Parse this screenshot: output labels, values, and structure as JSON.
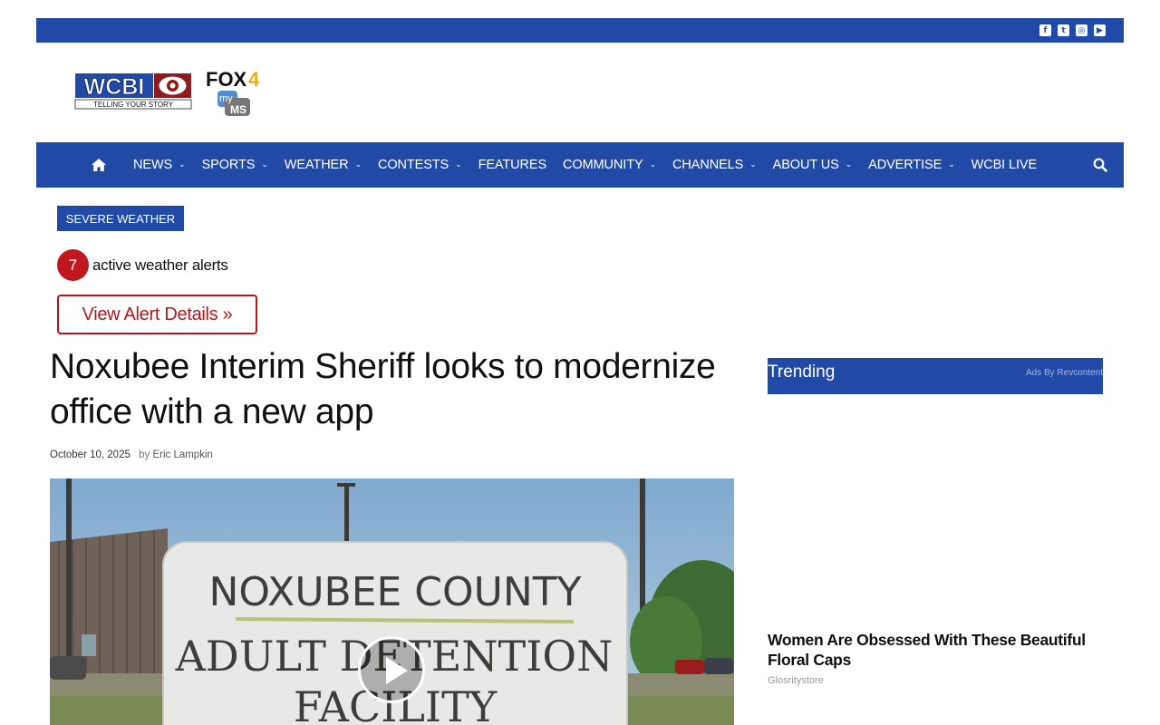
{
  "colors": {
    "brand_blue": "#2149a6",
    "alert_red": "#c0161d"
  },
  "social": [
    {
      "icon": "facebook-icon",
      "glyph": "f"
    },
    {
      "icon": "twitter-icon",
      "glyph": "t"
    },
    {
      "icon": "instagram-icon",
      "glyph": "◎"
    },
    {
      "icon": "youtube-icon",
      "glyph": "▶"
    }
  ],
  "logos": {
    "wcbi_text": "WCBI",
    "wcbi_tagline": "TELLING YOUR STORY",
    "fox_text": "FOX",
    "fox_number": "4",
    "my_text": "my",
    "ms_text": "MS"
  },
  "nav": {
    "items": [
      {
        "label": "NEWS",
        "dropdown": true
      },
      {
        "label": "SPORTS",
        "dropdown": true
      },
      {
        "label": "WEATHER",
        "dropdown": true
      },
      {
        "label": "CONTESTS",
        "dropdown": true
      },
      {
        "label": "FEATURES",
        "dropdown": false
      },
      {
        "label": "COMMUNITY",
        "dropdown": true
      },
      {
        "label": "CHANNELS",
        "dropdown": true
      },
      {
        "label": "ABOUT US",
        "dropdown": true
      },
      {
        "label": "ADVERTISE",
        "dropdown": true
      },
      {
        "label": "WCBI LIVE",
        "dropdown": false
      }
    ]
  },
  "weather": {
    "severe_label": "SEVERE WEATHER",
    "alert_count": "7",
    "alert_text": "active weather alerts",
    "details_label": "View Alert Details »"
  },
  "article": {
    "title": "Noxubee Interim Sheriff looks to modernize office with a new app",
    "date": "October 10, 2025",
    "by": "by",
    "author": "Eric Lampkin",
    "sign_line1": "NOXUBEE COUNTY",
    "sign_line2": "ADULT DETENTION",
    "sign_line3": "FACILITY"
  },
  "sidebar": {
    "trending_title": "Trending",
    "ads_by": "Ads By Revcontent",
    "ad_title": "Women Are Obsessed With These Beautiful Floral Caps",
    "ad_source": "Glosritystore"
  }
}
